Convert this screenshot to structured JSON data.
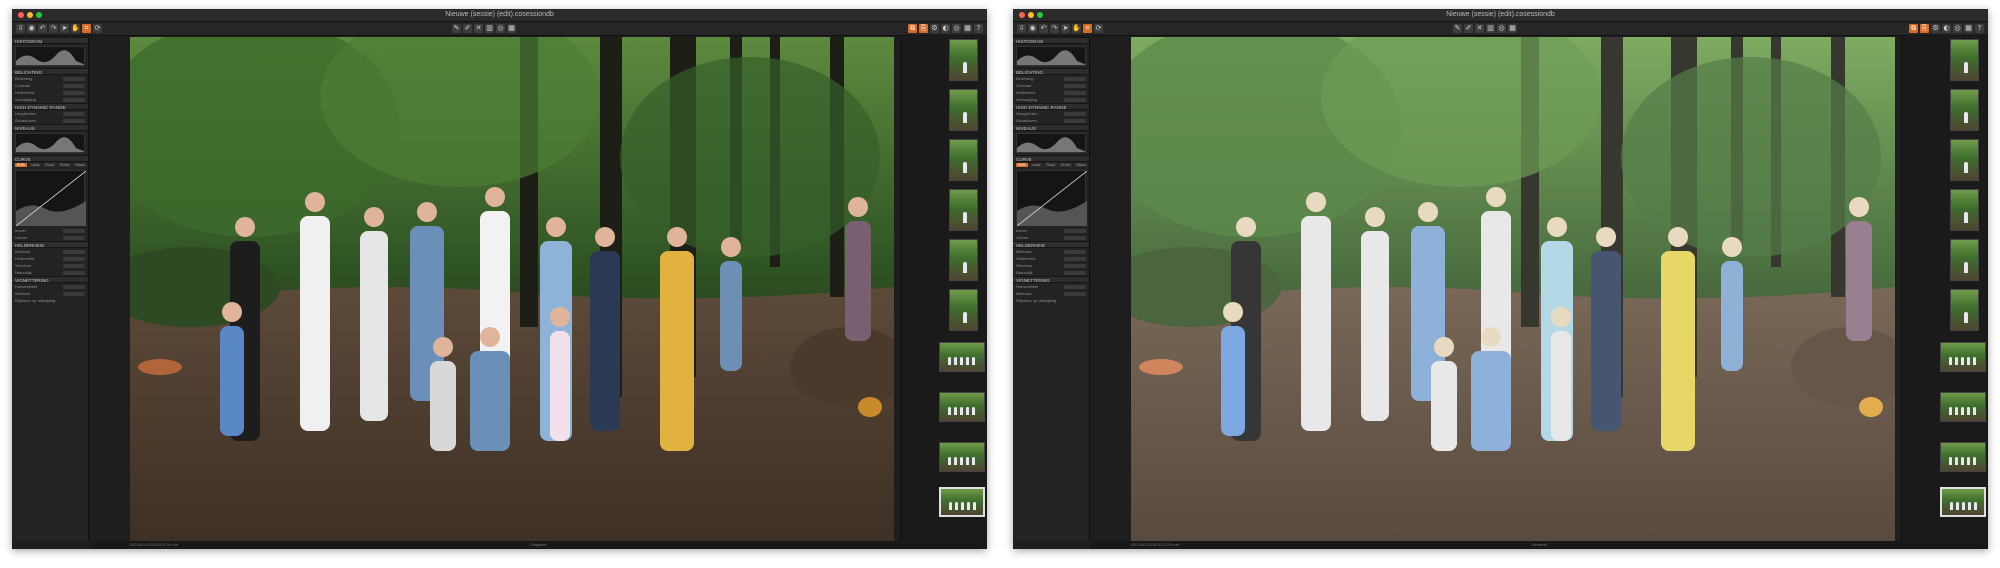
{
  "windows": [
    {
      "variant": "original",
      "title": "Nieuwe (sessie) (edit).cosessiondb",
      "left_panel": {
        "sections": [
          {
            "header": "Histogram",
            "rows": []
          },
          {
            "header": "Belichting",
            "rows": [
              "Belichting",
              "Contrast",
              "Helderheid",
              "Verzadiging"
            ]
          },
          {
            "header": "High Dynamic Range",
            "rows": [
              "Hooglichten",
              "Schaduwen"
            ]
          },
          {
            "header": "Niveaus",
            "rows": []
          },
          {
            "header": "Curve",
            "rows": [
              "Invoer",
              "Uitvoer"
            ]
          },
          {
            "header": "Helderheid",
            "rows": [
              "Methode",
              "Helderheid",
              "Structuur",
              "Natuurlijk"
            ]
          },
          {
            "header": "Vignettering",
            "rows": [
              "Hoeveelheid",
              "Methode"
            ]
          }
        ],
        "curve_tabs": [
          "RGB",
          "Luma",
          "Rood",
          "Groen",
          "Blauw"
        ],
        "method_value": "Natuurlijk",
        "vignette_method": "Elliptisch op uitsnijding"
      },
      "status_center": "Origineel",
      "status_left": "ISO 400  1/250  f/2.8  70 mm"
    },
    {
      "variant": "edited",
      "title": "Nieuwe (sessie) (edit).cosessiondb",
      "left_panel": {
        "sections": [
          {
            "header": "Histogram",
            "rows": []
          },
          {
            "header": "Belichting",
            "rows": [
              "Belichting",
              "Contrast",
              "Helderheid",
              "Verzadiging"
            ]
          },
          {
            "header": "High Dynamic Range",
            "rows": [
              "Hooglichten",
              "Schaduwen"
            ]
          },
          {
            "header": "Niveaus",
            "rows": []
          },
          {
            "header": "Curve",
            "rows": [
              "Invoer",
              "Uitvoer"
            ]
          },
          {
            "header": "Helderheid",
            "rows": [
              "Methode",
              "Helderheid",
              "Structuur",
              "Natuurlijk"
            ]
          },
          {
            "header": "Vignettering",
            "rows": [
              "Hoeveelheid",
              "Methode"
            ]
          }
        ],
        "curve_tabs": [
          "RGB",
          "Luma",
          "Rood",
          "Groen",
          "Blauw"
        ],
        "method_value": "Natuurlijk",
        "vignette_method": "Elliptisch op uitsnijding"
      },
      "status_center": "Bewerkt",
      "status_left": "ISO 400  1/250  f/2.8  70 mm"
    }
  ],
  "toolbar_icons": [
    "import-icon",
    "camera-icon",
    "undo-icon",
    "redo-icon",
    "cursor-icon",
    "pan-icon",
    "crop-icon",
    "rotate-icon",
    "picker-icon",
    "brush-icon",
    "erase-icon",
    "gradient-icon",
    "eye-icon",
    "grid-icon",
    "copy-icon",
    "paste-icon"
  ],
  "colors": {
    "accent": "#d86b26",
    "panel": "#232323",
    "window": "#1e1e1e"
  }
}
